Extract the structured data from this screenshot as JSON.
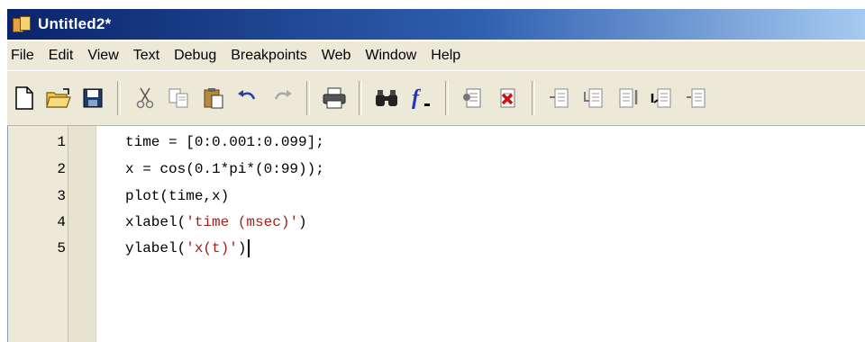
{
  "window": {
    "title": "Untitled2*"
  },
  "menubar": {
    "items": [
      "File",
      "Edit",
      "View",
      "Text",
      "Debug",
      "Breakpoints",
      "Web",
      "Window",
      "Help"
    ]
  },
  "toolbar": {
    "buttons": [
      {
        "name": "new-file-icon"
      },
      {
        "name": "open-folder-icon"
      },
      {
        "name": "save-icon"
      },
      {
        "name": "cut-icon"
      },
      {
        "name": "copy-icon"
      },
      {
        "name": "paste-icon"
      },
      {
        "name": "undo-icon"
      },
      {
        "name": "redo-icon"
      },
      {
        "name": "print-icon"
      },
      {
        "name": "find-binoculars-icon"
      },
      {
        "name": "function-icon"
      },
      {
        "name": "set-breakpoint-icon"
      },
      {
        "name": "clear-breakpoint-icon"
      },
      {
        "name": "step-icon"
      },
      {
        "name": "step-in-icon"
      },
      {
        "name": "step-out-icon"
      },
      {
        "name": "continue-icon"
      },
      {
        "name": "exit-debug-icon"
      }
    ]
  },
  "editor": {
    "lines": [
      {
        "num": "1",
        "code": "time = [0:0.001:0.099];"
      },
      {
        "num": "2",
        "code": "x = cos(0.1*pi*(0:99));"
      },
      {
        "num": "3",
        "code": "plot(time,x)"
      },
      {
        "num": "4",
        "prefix": "xlabel(",
        "string": "'time (msec)'",
        "suffix": ")"
      },
      {
        "num": "5",
        "prefix": "ylabel(",
        "string": "'x(t)'",
        "suffix": ")"
      }
    ]
  },
  "colors": {
    "titlebar_start": "#0a246a",
    "string": "#a0201c",
    "toolbar_bg": "#ece9d8"
  }
}
